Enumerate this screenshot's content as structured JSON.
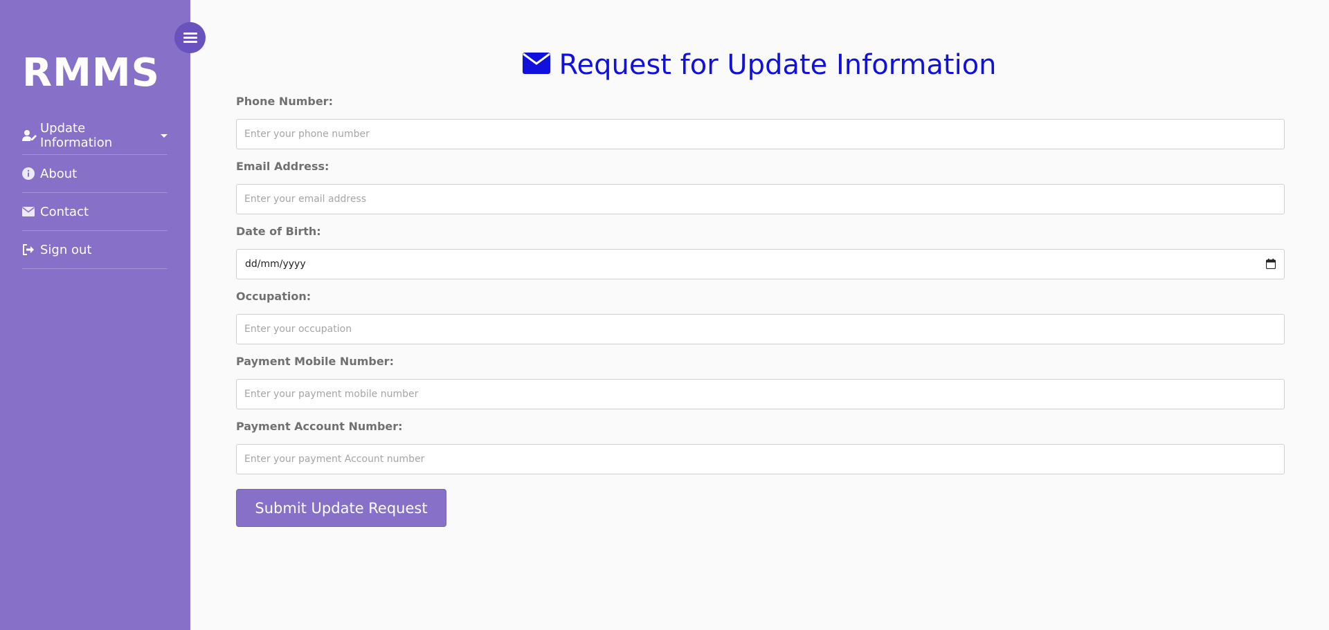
{
  "brand": "RMMS",
  "colors": {
    "sidebar": "#8670c8",
    "toggle": "#6a52be",
    "title": "#1111dd",
    "button": "#8670c8",
    "background": "#fafafa"
  },
  "sidebar": {
    "items": [
      {
        "label": "Update Information",
        "icon": "user-edit-icon",
        "has_dropdown": true
      },
      {
        "label": "About",
        "icon": "info-circle-icon"
      },
      {
        "label": "Contact",
        "icon": "envelope-icon"
      },
      {
        "label": "Sign out",
        "icon": "sign-out-icon"
      }
    ]
  },
  "main": {
    "title": "Request for Update Information",
    "title_icon": "envelope-icon",
    "fields": [
      {
        "label": "Phone Number:",
        "placeholder": "Enter your phone number",
        "value": ""
      },
      {
        "label": "Email Address:",
        "placeholder": "Enter your email address",
        "value": ""
      },
      {
        "label": "Date of Birth:",
        "placeholder": "dd/mm/yyyy",
        "value": ""
      },
      {
        "label": "Occupation:",
        "placeholder": "Enter your occupation",
        "value": ""
      },
      {
        "label": "Payment Mobile Number:",
        "placeholder": "Enter your payment mobile number",
        "value": ""
      },
      {
        "label": "Payment Account Number:",
        "placeholder": "Enter your payment Account number",
        "value": ""
      }
    ],
    "submit_label": "Submit Update Request"
  }
}
